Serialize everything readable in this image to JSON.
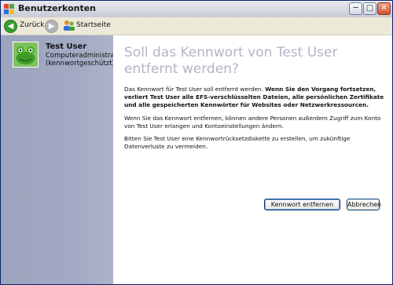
{
  "window": {
    "title": "Benutzerkonten"
  },
  "toolbar": {
    "back_label": "Zurück",
    "home_label": "Startseite"
  },
  "user": {
    "name": "Test User",
    "role": "Computeradministrator",
    "status": "(kennwortgeschützt)"
  },
  "main": {
    "heading": "Soll das Kennwort von Test User entfernt werden?",
    "para1_plain": "Das Kennwort für Test User soll entfernt werden. ",
    "para1_bold": "Wenn Sie den Vorgang fortsetzen, verliert Test User alle EFS-verschlüsselten Dateien, alle persönlichen Zertifikate und alle gespeicherten Kennwörter für Websites oder Netzwerkressourcen.",
    "para2": "Wenn Sie das Kennwort entfernen, können andere Personen außerdem Zugriff zum Konto von Test User erlangen und Kontoeinstellungen ändern.",
    "para3": "Bitten Sie Test User eine Kennwortrücksetzdiskette zu erstellen, um zukünftige Datenverluste zu vermeiden.",
    "remove_button": "Kennwort entfernen",
    "cancel_button": "Abbrechen"
  },
  "colors": {
    "title_accent": "#0a246a",
    "heading_gray": "#b2b6c4",
    "left_pane": "#a3aac3"
  }
}
